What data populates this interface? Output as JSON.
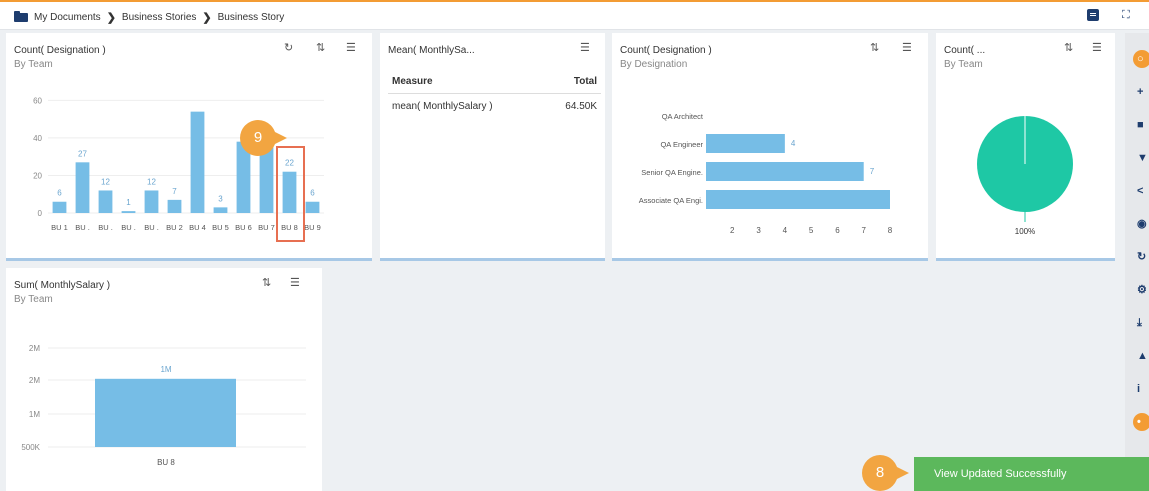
{
  "breadcrumb": {
    "items": [
      "My Documents",
      "Business Stories",
      "Business Story"
    ]
  },
  "colors": {
    "bar": "#76bde6",
    "pie": "#1ec8a5",
    "accent": "#f39c34",
    "toast": "#5cb85c",
    "highlight": "#e76f51"
  },
  "cards": {
    "designation_team": {
      "title": "Count( Designation )",
      "subtitle": "By Team",
      "chart_data": {
        "type": "bar",
        "categories": [
          "BU 1",
          "BU .",
          "BU .",
          "BU .",
          "BU .",
          "BU 2",
          "BU 4",
          "BU 5",
          "BU 6",
          "BU 7",
          "BU 8",
          "BU 9"
        ],
        "values": [
          6,
          27,
          12,
          1,
          12,
          7,
          54,
          3,
          38,
          35,
          22,
          6
        ],
        "data_labels": [
          "6",
          "27",
          "12",
          "1",
          "12",
          "7",
          "",
          "3",
          "",
          "",
          "22",
          "6"
        ],
        "yticks": [
          "0",
          "20",
          "40",
          "60"
        ],
        "ylim": [
          0,
          65
        ]
      }
    },
    "mean_salary": {
      "title": "Mean( MonthlySa...",
      "table": {
        "col_measure": "Measure",
        "col_total": "Total",
        "row_measure": "mean( MonthlySalary )",
        "row_total": "64.50K"
      }
    },
    "designation_by_designation": {
      "title": "Count( Designation )",
      "subtitle": "By Designation",
      "chart_data": {
        "type": "bar",
        "orientation": "horizontal",
        "categories": [
          "QA Architect",
          "QA Engineer",
          "Senior QA Engine.",
          "Associate QA Engi."
        ],
        "values": [
          1,
          4,
          7,
          8
        ],
        "data_labels": [
          "",
          "4",
          "7",
          ""
        ],
        "xticks": [
          "2",
          "3",
          "4",
          "5",
          "6",
          "7",
          "8"
        ],
        "xlim": [
          1,
          8
        ]
      }
    },
    "count_team": {
      "title": "Count( ...",
      "subtitle": "By Team",
      "chart_data": {
        "type": "pie",
        "values": [
          100
        ],
        "labels": [
          "100%"
        ]
      }
    },
    "sum_salary": {
      "title": "Sum( MonthlySalary )",
      "subtitle": "By Team",
      "chart_data": {
        "type": "bar",
        "categories": [
          "BU 8"
        ],
        "values": [
          1800000
        ],
        "data_labels": [
          "1M"
        ],
        "yticks": [
          "500K",
          "1M",
          "2M",
          "2M"
        ],
        "ylim": [
          250000,
          2500000
        ]
      }
    }
  },
  "rail": {
    "icons": [
      "search-icon",
      "plus-icon",
      "save-icon",
      "filter-icon",
      "share-icon",
      "eye-icon",
      "refresh-icon",
      "settings-icon",
      "export-icon",
      "alert-icon",
      "info-icon",
      "bulb-icon"
    ]
  },
  "steps": {
    "step9": "9",
    "step8": "8"
  },
  "toast": {
    "message": "View Updated Successfully"
  }
}
